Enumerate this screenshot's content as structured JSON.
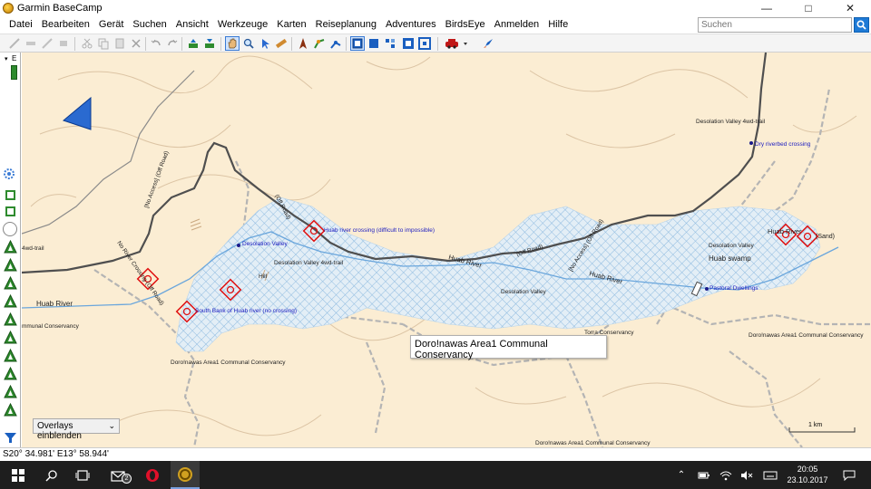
{
  "window": {
    "title": "Garmin BaseCamp",
    "controls": [
      "minimize",
      "maximize",
      "close"
    ]
  },
  "menu": [
    "Datei",
    "Bearbeiten",
    "Gerät",
    "Suchen",
    "Ansicht",
    "Werkzeuge",
    "Karten",
    "Reiseplanung",
    "Adventures",
    "BirdsEye",
    "Anmelden",
    "Hilfe"
  ],
  "search": {
    "placeholder": "Suchen"
  },
  "left_panel": {
    "tree_label": "E"
  },
  "map": {
    "labels": {
      "desolation_trail_ne": "Desolation Valley 4wd-trail",
      "dry_riverbed": "Dry riverbed crossing",
      "desolation_valley_poi": "Desolation Valley",
      "desolation_trail_mid": "Desolation Valley 4wd-trail",
      "hill": "Hill",
      "huab_crossing": "Huab river crossing (difficult to impossible)",
      "south_bank": "South Bank of Huab river (no crossing)",
      "desolation_valley_center": "Desolation Valley",
      "desolation_valley_east": "Desolation Valley",
      "huab_swamp": "Huab swamp",
      "pastoral": "Pastoral Dwellings",
      "huab_river_w": "Huab River",
      "huab_river_c": "Huab River",
      "huab_river_e": "Huab River",
      "huab_river_ne": "Huab River",
      "sand": "(Sand)",
      "wd_trail_left": "4wd-trail",
      "communal_left": "mmunal Conservancy",
      "doro_left": "Doro!nawas Area1 Communal Conservancy",
      "torra": "Torra Conservancy",
      "doro_right": "Doro!nawas Area1 Communal Conservancy",
      "doro_bottom": "Doro!nawas Area1 Communal Conservancy",
      "no_access_1": "[No Access] (Off Road)",
      "no_access_2": "No River Crossing (Off Road)",
      "off_road_1": "(Off Road)",
      "off_road_2": "(Off Road)",
      "no_access_3": "[No Access] (Off Road)"
    },
    "tooltip": "Doro!nawas Area1 Communal Conservancy",
    "overlay_button": "Overlays einblenden",
    "scale": "1 km"
  },
  "status": {
    "coordinates": "S20° 34.981' E13° 58.944'"
  },
  "taskbar": {
    "mail_badge": "2",
    "time": "20:05",
    "date": "23.10.2017"
  },
  "colors": {
    "map_bg": "#fbedd3",
    "water": "#9dc6e8",
    "road": "#4a4a4a",
    "contour": "#d9c3a6",
    "boundary": "#a9a9a9",
    "waypoint": "#e01010"
  }
}
